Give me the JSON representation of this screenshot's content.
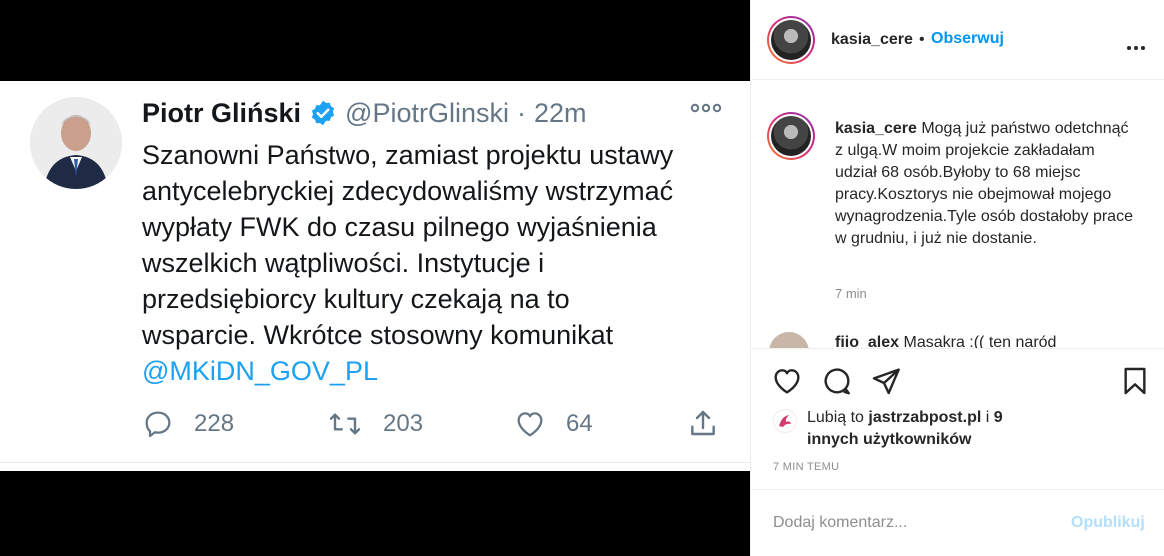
{
  "tweet": {
    "name": "Piotr Gliński",
    "handle": "@PiotrGlinski",
    "dot": "·",
    "time": "22m",
    "lines": [
      "Szanowni Państwo, zamiast projektu ustawy",
      "antycelebryckiej zdecydowaliśmy wstrzymać",
      "wypłaty FWK do czasu pilnego wyjaśnienia",
      "wszelkich wątpliwości. Instytucje i",
      "przedsiębiorcy kultury czekają na to",
      "wsparcie. Wkrótce stosowny komunikat"
    ],
    "mention": "@MKiDN_GOV_PL",
    "replies": "228",
    "retweets": "203",
    "likes": "64",
    "link_color": "#1da1f2"
  },
  "header": {
    "username": "kasia_cere",
    "dot": "•",
    "follow_label": "Obserwuj"
  },
  "caption": {
    "username": "kasia_cere",
    "text": "Mogą już państwo odetchnąć z ulgą.W moim projekcie zakładałam udział 68 osób.Byłoby to 68 miejsc pracy.Kosztorys nie obejmował mojego wynagrodzenia.Tyle osób dostałoby prace w grudniu, i już nie dostanie.",
    "time": "7 min"
  },
  "comment2": {
    "username": "fiio_alex",
    "text": "Masakra :(( ten naród"
  },
  "likes": {
    "prefix": "Lubią to",
    "liker": "jastrzabpost.pl",
    "conj": "i",
    "others": "9 innych użytkowników"
  },
  "post_time": "7 MIN TEMU",
  "add_comment": {
    "placeholder": "Dodaj komentarz...",
    "publish_label": "Opublikuj"
  },
  "colors": {
    "accent": "#0095f6",
    "text": "#262626",
    "muted": "#8e8e8e"
  }
}
